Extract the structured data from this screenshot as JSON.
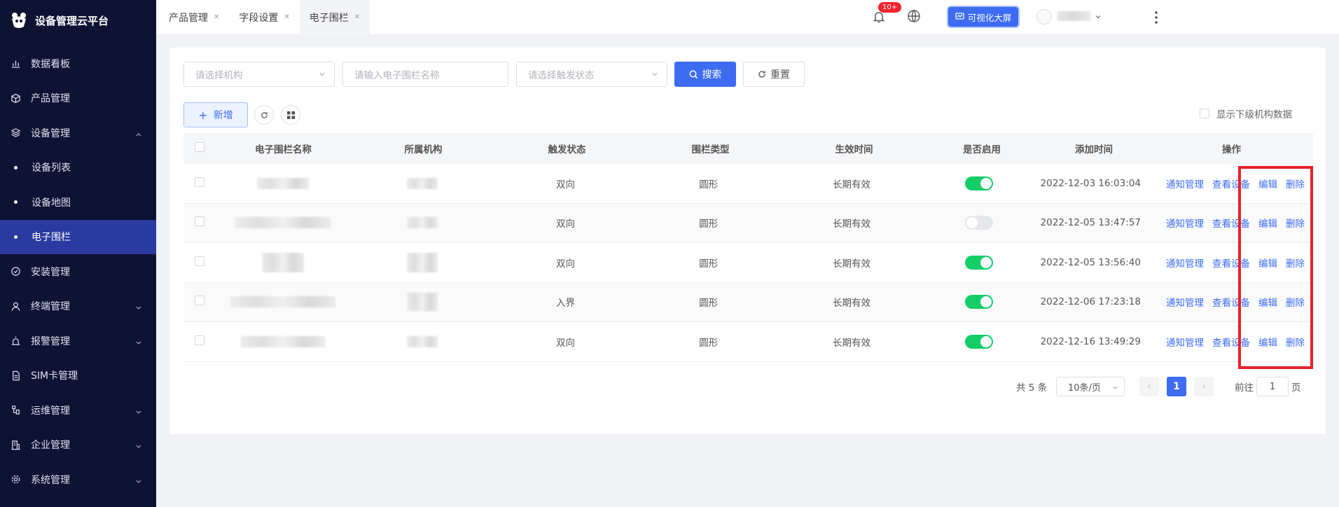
{
  "app": {
    "title": "设备管理云平台"
  },
  "sidebar": {
    "items": [
      {
        "label": "数据看板",
        "icon": "bar-chart-icon",
        "expandable": false
      },
      {
        "label": "产品管理",
        "icon": "cube-icon",
        "expandable": false
      },
      {
        "label": "设备管理",
        "icon": "layers-icon",
        "expandable": true,
        "expanded": true
      },
      {
        "label": "设备列表",
        "sub": true
      },
      {
        "label": "设备地图",
        "sub": true
      },
      {
        "label": "电子围栏",
        "sub": true,
        "active": true
      },
      {
        "label": "安装管理",
        "icon": "check-circle-icon",
        "expandable": false
      },
      {
        "label": "终端管理",
        "icon": "user-icon",
        "expandable": true
      },
      {
        "label": "报警管理",
        "icon": "alarm-icon",
        "expandable": true
      },
      {
        "label": "SIM卡管理",
        "icon": "sim-card-icon",
        "expandable": false
      },
      {
        "label": "运维管理",
        "icon": "tool-icon",
        "expandable": true
      },
      {
        "label": "企业管理",
        "icon": "building-icon",
        "expandable": true
      },
      {
        "label": "系统管理",
        "icon": "gear-icon",
        "expandable": true
      }
    ]
  },
  "header": {
    "tabs": [
      {
        "label": "产品管理",
        "active": false
      },
      {
        "label": "字段设置",
        "active": false
      },
      {
        "label": "电子围栏",
        "active": true
      }
    ],
    "notification_badge": "10+",
    "bigscreen_label": "可视化大屏"
  },
  "filters": {
    "org_placeholder": "请选择机构",
    "name_placeholder": "请输入电子围栏名称",
    "trigger_placeholder": "请选择触发状态",
    "search_label": "搜索",
    "reset_label": "重置"
  },
  "toolbar": {
    "add_label": "新增",
    "show_sub_label": "显示下级机构数据"
  },
  "table": {
    "columns": [
      "电子围栏名称",
      "所属机构",
      "触发状态",
      "围栏类型",
      "生效时间",
      "是否启用",
      "添加时间",
      "操作"
    ],
    "rows": [
      {
        "trigger": "双向",
        "type": "圆形",
        "effective": "长期有效",
        "enabled": true,
        "added": "2022-12-03 16:03:04"
      },
      {
        "trigger": "双向",
        "type": "圆形",
        "effective": "长期有效",
        "enabled": false,
        "added": "2022-12-05 13:47:57"
      },
      {
        "trigger": "双向",
        "type": "圆形",
        "effective": "长期有效",
        "enabled": true,
        "added": "2022-12-05 13:56:40"
      },
      {
        "trigger": "入界",
        "type": "圆形",
        "effective": "长期有效",
        "enabled": true,
        "added": "2022-12-06 17:23:18"
      },
      {
        "trigger": "双向",
        "type": "圆形",
        "effective": "长期有效",
        "enabled": true,
        "added": "2022-12-16 13:49:29"
      }
    ],
    "actions": {
      "notify": "通知管理",
      "view": "查看设备",
      "edit": "编辑",
      "delete": "删除"
    }
  },
  "pagination": {
    "total_text": "共 5 条",
    "page_size": "10条/页",
    "current_page": "1",
    "goto_label": "前往",
    "goto_value": "1",
    "page_suffix": "页"
  },
  "colors": {
    "sidebar_bg": "#0e1233",
    "primary": "#3d6cf2",
    "switch_on": "#13ce66",
    "highlight": "#e8212a"
  }
}
